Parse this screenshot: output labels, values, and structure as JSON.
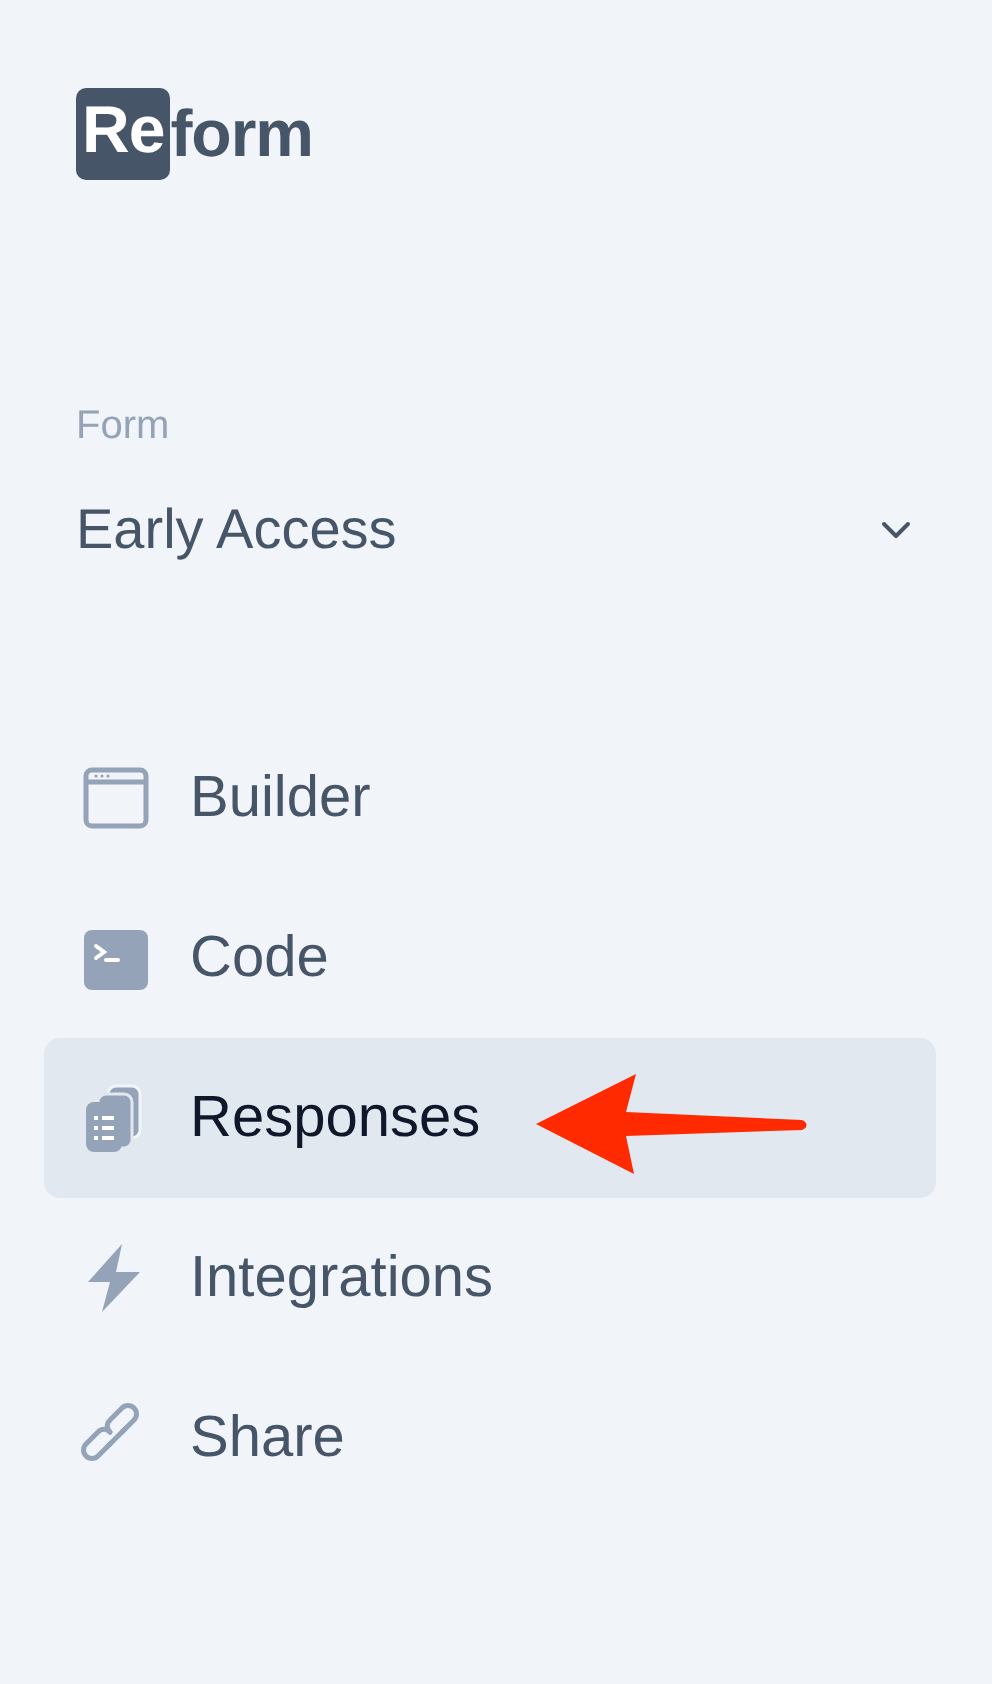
{
  "logo": {
    "boxed": "Re",
    "rest": "form"
  },
  "form_picker": {
    "label": "Form",
    "value": "Early Access"
  },
  "nav": [
    {
      "label": "Builder",
      "kind": "window",
      "selected": false
    },
    {
      "label": "Code",
      "kind": "terminal",
      "selected": false
    },
    {
      "label": "Responses",
      "kind": "copies",
      "selected": true
    },
    {
      "label": "Integrations",
      "kind": "bolt",
      "selected": false
    },
    {
      "label": "Share",
      "kind": "link",
      "selected": false
    }
  ]
}
